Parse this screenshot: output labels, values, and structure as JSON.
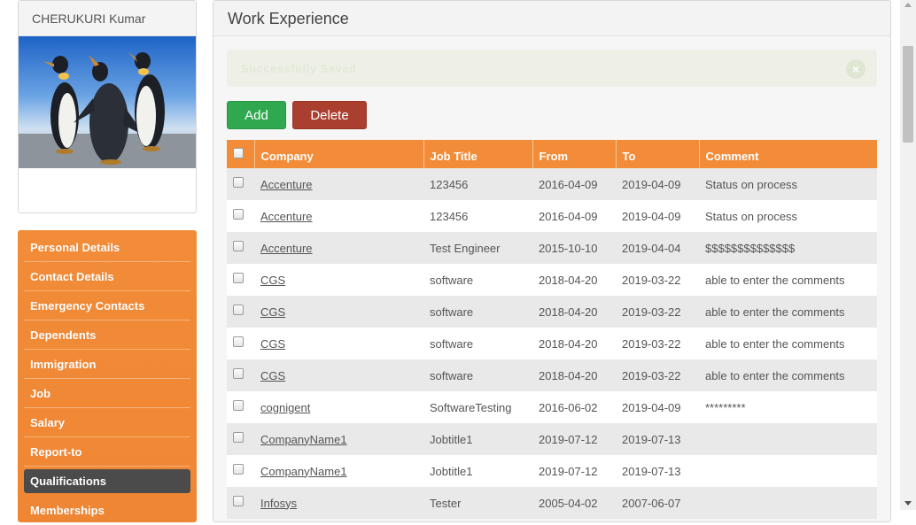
{
  "profile": {
    "name": "CHERUKURI Kumar"
  },
  "sidebar": {
    "items": [
      {
        "label": "Personal Details",
        "active": false
      },
      {
        "label": "Contact Details",
        "active": false
      },
      {
        "label": "Emergency Contacts",
        "active": false
      },
      {
        "label": "Dependents",
        "active": false
      },
      {
        "label": "Immigration",
        "active": false
      },
      {
        "label": "Job",
        "active": false
      },
      {
        "label": "Salary",
        "active": false
      },
      {
        "label": "Report-to",
        "active": false
      },
      {
        "label": "Qualifications",
        "active": true
      },
      {
        "label": "Memberships",
        "active": false
      }
    ]
  },
  "main": {
    "title": "Work Experience",
    "message": "Successfully Saved",
    "close_symbol": "×",
    "add_label": "Add",
    "delete_label": "Delete",
    "columns": [
      "Company",
      "Job Title",
      "From",
      "To",
      "Comment"
    ],
    "rows": [
      {
        "company": "Accenture",
        "job_title": "123456",
        "from": "2016-04-09",
        "to": "2019-04-09",
        "comment": "Status on process"
      },
      {
        "company": "Accenture",
        "job_title": "123456",
        "from": "2016-04-09",
        "to": "2019-04-09",
        "comment": "Status on process"
      },
      {
        "company": "Accenture",
        "job_title": "Test Engineer",
        "from": "2015-10-10",
        "to": "2019-04-04",
        "comment": "$$$$$$$$$$$$$$"
      },
      {
        "company": "CGS",
        "job_title": "software",
        "from": "2018-04-20",
        "to": "2019-03-22",
        "comment": "able to enter the comments"
      },
      {
        "company": "CGS",
        "job_title": "software",
        "from": "2018-04-20",
        "to": "2019-03-22",
        "comment": "able to enter the comments"
      },
      {
        "company": "CGS",
        "job_title": "software",
        "from": "2018-04-20",
        "to": "2019-03-22",
        "comment": "able to enter the comments"
      },
      {
        "company": "CGS",
        "job_title": "software",
        "from": "2018-04-20",
        "to": "2019-03-22",
        "comment": "able to enter the comments"
      },
      {
        "company": "cognigent",
        "job_title": "SoftwareTesting",
        "from": "2016-06-02",
        "to": "2019-04-09",
        "comment": "*********"
      },
      {
        "company": "CompanyName1",
        "job_title": "Jobtitle1",
        "from": "2019-07-12",
        "to": "2019-07-13",
        "comment": ""
      },
      {
        "company": "CompanyName1",
        "job_title": "Jobtitle1",
        "from": "2019-07-12",
        "to": "2019-07-13",
        "comment": ""
      },
      {
        "company": "Infosys",
        "job_title": "Tester",
        "from": "2005-04-02",
        "to": "2007-06-07",
        "comment": ""
      }
    ]
  },
  "colors": {
    "accent": "#f28c38",
    "add": "#2fa84f",
    "delete": "#aa3f30",
    "active_nav": "#4b4b4b"
  },
  "icons": {
    "profile_photo": "penguins-photo",
    "message_close": "close-icon"
  }
}
